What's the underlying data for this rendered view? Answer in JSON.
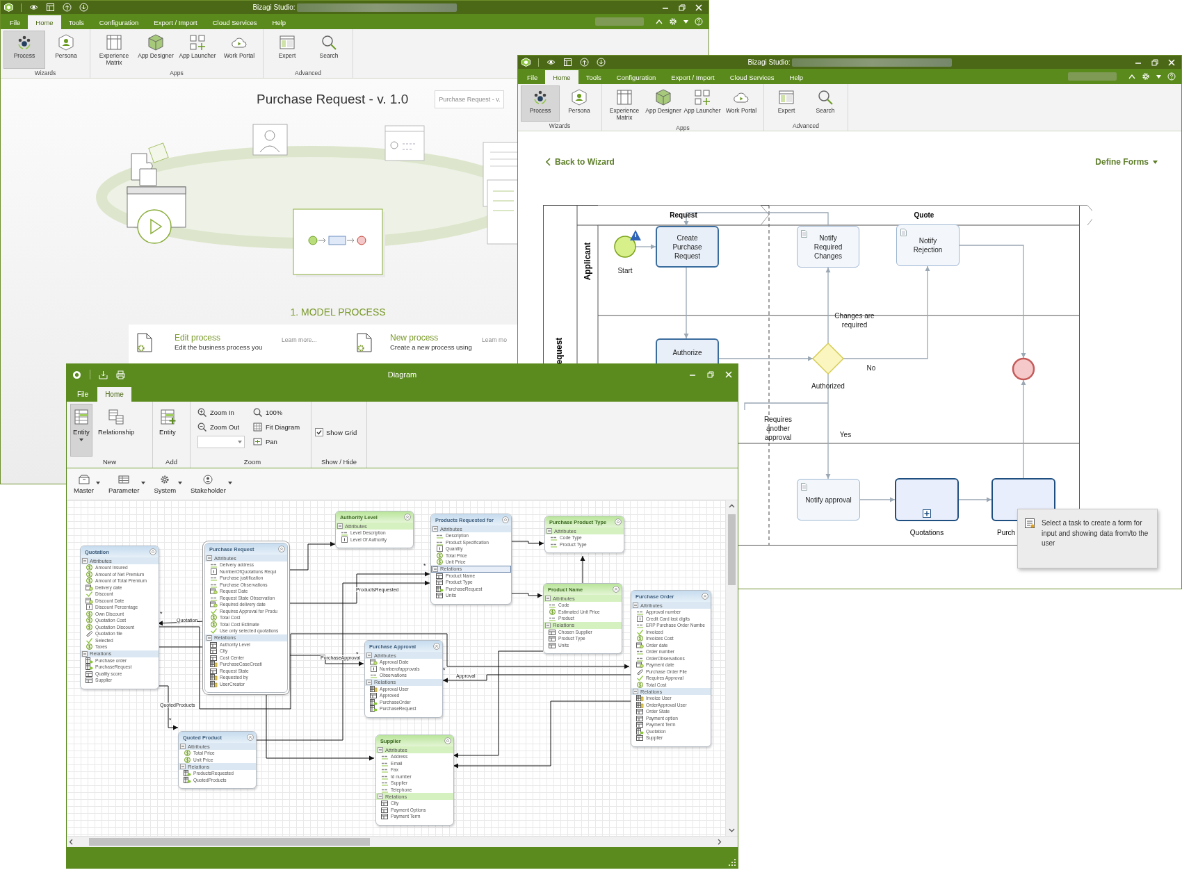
{
  "wizard_window": {
    "title": "Bizagi Studio:",
    "menu_tabs": [
      {
        "label": "File",
        "selected": false
      },
      {
        "label": "Home",
        "selected": true
      },
      {
        "label": "Tools",
        "selected": false
      },
      {
        "label": "Configuration",
        "selected": false
      },
      {
        "label": "Export / Import",
        "selected": false
      },
      {
        "label": "Cloud Services",
        "selected": false
      },
      {
        "label": "Help",
        "selected": false
      }
    ],
    "ribbon_groups": [
      {
        "label": "Wizards",
        "buttons": [
          {
            "label": "Process",
            "selected": true
          },
          {
            "label": "Persona",
            "selected": false
          }
        ]
      },
      {
        "label": "Apps",
        "buttons": [
          {
            "label": "Experience Matrix",
            "selected": false
          },
          {
            "label": "App Designer",
            "selected": false
          },
          {
            "label": "App Launcher",
            "selected": false
          },
          {
            "label": "Work Portal",
            "selected": false
          }
        ]
      },
      {
        "label": "Advanced",
        "buttons": [
          {
            "label": "Expert",
            "selected": false
          },
          {
            "label": "Search",
            "selected": false
          }
        ]
      }
    ],
    "process_title": "Purchase Request - v. 1.0",
    "process_search": {
      "value": "Purchase Request - v."
    },
    "step_title": "1. MODEL PROCESS",
    "options": [
      {
        "title": "Edit process",
        "description": "Edit the business process you",
        "link": "Learn more..."
      },
      {
        "title": "New process",
        "description": "Create a new process using",
        "link": "Learn mo"
      }
    ]
  },
  "process_window": {
    "title": "Bizagi Studio:",
    "menu_tabs": [
      {
        "label": "File",
        "selected": false
      },
      {
        "label": "Home",
        "selected": true
      },
      {
        "label": "Tools",
        "selected": false
      },
      {
        "label": "Configuration",
        "selected": false
      },
      {
        "label": "Export / Import",
        "selected": false
      },
      {
        "label": "Cloud Services",
        "selected": false
      },
      {
        "label": "Help",
        "selected": false
      }
    ],
    "ribbon_groups": [
      {
        "label": "Wizards",
        "buttons": [
          {
            "label": "Process",
            "selected": true
          },
          {
            "label": "Persona",
            "selected": false
          }
        ]
      },
      {
        "label": "Apps",
        "buttons": [
          {
            "label": "Experience Matrix",
            "selected": false
          },
          {
            "label": "App Designer",
            "selected": false
          },
          {
            "label": "App Launcher",
            "selected": false
          },
          {
            "label": "Work Portal",
            "selected": false
          }
        ]
      },
      {
        "label": "Advanced",
        "buttons": [
          {
            "label": "Expert",
            "selected": false
          },
          {
            "label": "Search",
            "selected": false
          }
        ]
      }
    ],
    "back_link": "Back to Wizard",
    "forms_menu": "Define Forms",
    "lanes": [
      {
        "label": "Applicant"
      },
      {
        "label": "equest"
      }
    ],
    "phases": [
      {
        "label": "Request"
      },
      {
        "label": "Quote"
      }
    ],
    "nodes": [
      {
        "kind": "start",
        "label": "Start",
        "warning": true
      },
      {
        "kind": "task",
        "label": "Create Purchase Request",
        "warning": false
      },
      {
        "kind": "notify",
        "label": "Notify Required Changes",
        "warning": false
      },
      {
        "kind": "notify",
        "label": "Notify Rejection",
        "warning": false
      },
      {
        "kind": "task",
        "label": "Authorize",
        "warning": false
      },
      {
        "kind": "gateway",
        "label": "Authorized",
        "warning": false
      },
      {
        "kind": "end",
        "warning": false
      },
      {
        "kind": "notify",
        "label": "Notify approval",
        "warning": false
      },
      {
        "kind": "subprocess",
        "label": "Quotations",
        "warning": false,
        "expand_marker": true
      },
      {
        "kind": "subprocess",
        "label": "Purch",
        "warning": false,
        "expand_marker": false
      }
    ],
    "flows": [
      {
        "arrow": true
      },
      {
        "arrow": true
      },
      {
        "arrow": true
      },
      {
        "arrow": true
      },
      {
        "arrow": true,
        "label": "Changes are required"
      },
      {
        "arrow": true,
        "label": "No"
      },
      {
        "arrow": true,
        "label": "Yes"
      },
      {
        "arrow": false,
        "label": "Requires another approval"
      },
      {
        "arrow": true
      },
      {
        "arrow": true
      },
      {
        "arrow": true
      },
      {
        "arrow": true
      }
    ],
    "tooltip": "Select a task to create a form for input and showing data from/to the user"
  },
  "diagram_window": {
    "title": "Diagram",
    "menu_tabs": [
      {
        "label": "File",
        "selected": false
      },
      {
        "label": "Home",
        "selected": true
      }
    ],
    "ribbon": {
      "new_group": {
        "label": "New",
        "buttons": [
          {
            "label": "Entity",
            "selected": true,
            "dropdown": true
          },
          {
            "label": "Relationship",
            "selected": false,
            "dropdown": false
          }
        ]
      },
      "add_group": {
        "label": "Add",
        "buttons": [
          {
            "label": "Entity",
            "selected": false,
            "dropdown": false
          }
        ]
      },
      "zoom_group": {
        "label": "Zoom",
        "commands": [
          {
            "label": "Zoom In"
          },
          {
            "label": "Zoom Out"
          },
          {
            "label": "100%"
          },
          {
            "label": "Fit Diagram"
          },
          {
            "label": "Pan"
          }
        ]
      },
      "show_group": {
        "label": "Show / Hide",
        "show_grid": {
          "label": "Show Grid",
          "checked": true
        }
      }
    },
    "toolbar": [
      {
        "label": "Master"
      },
      {
        "label": "Parameter"
      },
      {
        "label": "System"
      },
      {
        "label": "Stakeholder"
      }
    ],
    "entities": [
      {
        "name": "Quotation",
        "kind": "master",
        "selected": false,
        "sections": [
          {
            "label": "Attributes",
            "selected": false,
            "items": [
              {
                "label": "Amount Insured",
                "kind": "currency"
              },
              {
                "label": "Amount of Net Premium",
                "kind": "currency"
              },
              {
                "label": "Amount of Total Premium",
                "kind": "currency"
              },
              {
                "label": "Delivery date",
                "kind": "date"
              },
              {
                "label": "Discount",
                "kind": "boolean"
              },
              {
                "label": "Discount Date",
                "kind": "date"
              },
              {
                "label": "Discount Percentage",
                "kind": "number"
              },
              {
                "label": "Own Discount",
                "kind": "currency"
              },
              {
                "label": "Quotation Cost",
                "kind": "currency"
              },
              {
                "label": "Quotation Discount",
                "kind": "currency"
              },
              {
                "label": "Quotation file",
                "kind": "file"
              },
              {
                "label": "Selected",
                "kind": "boolean"
              },
              {
                "label": "Taxes",
                "kind": "currency"
              }
            ]
          },
          {
            "label": "Relations",
            "selected": false,
            "items": [
              {
                "label": "Purchase order",
                "kind": "collection"
              },
              {
                "label": "PurchaseRequest",
                "kind": "collection"
              },
              {
                "label": "Quality score",
                "kind": "table"
              },
              {
                "label": "Supplier",
                "kind": "table"
              }
            ]
          }
        ]
      },
      {
        "name": "Purchase Request",
        "kind": "master",
        "selected": true,
        "sections": [
          {
            "label": "Attributes",
            "selected": false,
            "items": [
              {
                "label": "Delivery address",
                "kind": "text"
              },
              {
                "label": "NumberOfQuotations Requi",
                "kind": "number"
              },
              {
                "label": "Purchase justification",
                "kind": "text"
              },
              {
                "label": "Purchase Observations",
                "kind": "text"
              },
              {
                "label": "Request Date",
                "kind": "date"
              },
              {
                "label": "Request State Observation",
                "kind": "text"
              },
              {
                "label": "Required delivery date",
                "kind": "date"
              },
              {
                "label": "Requires Approval for Produ",
                "kind": "boolean"
              },
              {
                "label": "Total Cost",
                "kind": "currency"
              },
              {
                "label": "Total Cost Estimate",
                "kind": "currency"
              },
              {
                "label": "Use only selected quotations",
                "kind": "boolean"
              }
            ]
          },
          {
            "label": "Relations",
            "selected": false,
            "items": [
              {
                "label": "Authority Level",
                "kind": "table"
              },
              {
                "label": "City",
                "kind": "table"
              },
              {
                "label": "Cost Center",
                "kind": "table"
              },
              {
                "label": "PurchaseCaseCreati",
                "kind": "user"
              },
              {
                "label": "Request State",
                "kind": "table"
              },
              {
                "label": "Requested by",
                "kind": "user"
              },
              {
                "label": "UserCreator",
                "kind": "user"
              }
            ]
          }
        ]
      },
      {
        "name": "Authority Level",
        "kind": "parameter",
        "selected": false,
        "sections": [
          {
            "label": "Attributes",
            "selected": false,
            "items": [
              {
                "label": "Level Description",
                "kind": "text"
              },
              {
                "label": "Level Of Authority",
                "kind": "number"
              }
            ]
          }
        ]
      },
      {
        "name": "Products Requested for",
        "kind": "master",
        "selected": false,
        "sections": [
          {
            "label": "Attributes",
            "selected": false,
            "items": [
              {
                "label": "Description",
                "kind": "text"
              },
              {
                "label": "Product Specification",
                "kind": "text"
              },
              {
                "label": "Quantity",
                "kind": "number"
              },
              {
                "label": "Total Price",
                "kind": "currency"
              },
              {
                "label": "Unit Price",
                "kind": "currency"
              }
            ]
          },
          {
            "label": "Relations",
            "selected": true,
            "items": [
              {
                "label": "Product Name",
                "kind": "table"
              },
              {
                "label": "Product Type",
                "kind": "table"
              },
              {
                "label": "PurchaseRequest",
                "kind": "collection"
              },
              {
                "label": "Units",
                "kind": "table"
              }
            ]
          }
        ]
      },
      {
        "name": "Purchase Product Type",
        "kind": "parameter",
        "selected": false,
        "sections": [
          {
            "label": "Attributes",
            "selected": false,
            "items": [
              {
                "label": "Code Type",
                "kind": "text"
              },
              {
                "label": "Product Type",
                "kind": "text"
              }
            ]
          }
        ]
      },
      {
        "name": "Product Name",
        "kind": "parameter",
        "selected": false,
        "sections": [
          {
            "label": "Attributes",
            "selected": false,
            "items": [
              {
                "label": "Code",
                "kind": "text"
              },
              {
                "label": "Estimated Unit Price",
                "kind": "currency"
              },
              {
                "label": "Product",
                "kind": "text"
              }
            ]
          },
          {
            "label": "Relations",
            "selected": false,
            "items": [
              {
                "label": "Chosen Supplier",
                "kind": "table"
              },
              {
                "label": "Product Type",
                "kind": "table"
              },
              {
                "label": "Units",
                "kind": "table"
              }
            ]
          }
        ]
      },
      {
        "name": "Purchase Order",
        "kind": "master",
        "selected": false,
        "sections": [
          {
            "label": "Attributes",
            "selected": false,
            "items": [
              {
                "label": "Approval number",
                "kind": "text"
              },
              {
                "label": "Credit Card last digits",
                "kind": "number"
              },
              {
                "label": "ERP Purchase Order Numbe",
                "kind": "text"
              },
              {
                "label": "Invoiced",
                "kind": "boolean"
              },
              {
                "label": "Invoices Cost",
                "kind": "currency"
              },
              {
                "label": "Order date",
                "kind": "date"
              },
              {
                "label": "Order number",
                "kind": "text"
              },
              {
                "label": "OrderObservations",
                "kind": "text"
              },
              {
                "label": "Payment date",
                "kind": "date"
              },
              {
                "label": "Purchase Order File",
                "kind": "file"
              },
              {
                "label": "Requires Approval",
                "kind": "boolean"
              },
              {
                "label": "Total Cost",
                "kind": "currency"
              }
            ]
          },
          {
            "label": "Relations",
            "selected": false,
            "items": [
              {
                "label": "Invoice User",
                "kind": "user"
              },
              {
                "label": "OrderApproval User",
                "kind": "user"
              },
              {
                "label": "Order State",
                "kind": "table"
              },
              {
                "label": "Payment option",
                "kind": "table"
              },
              {
                "label": "Payment Term",
                "kind": "table"
              },
              {
                "label": "Quotation",
                "kind": "collection"
              },
              {
                "label": "Supplier",
                "kind": "table"
              }
            ]
          }
        ]
      },
      {
        "name": "Purchase Approval",
        "kind": "master",
        "selected": false,
        "sections": [
          {
            "label": "Attributes",
            "selected": false,
            "items": [
              {
                "label": "Approval Date",
                "kind": "date"
              },
              {
                "label": "Numberofapprovals",
                "kind": "number"
              },
              {
                "label": "Observations",
                "kind": "text"
              }
            ]
          },
          {
            "label": "Relations",
            "selected": false,
            "items": [
              {
                "label": "Approval User",
                "kind": "user"
              },
              {
                "label": "Approved",
                "kind": "table"
              },
              {
                "label": "PurchaseOrder",
                "kind": "collection"
              },
              {
                "label": "PurchaseRequest",
                "kind": "collection"
              }
            ]
          }
        ]
      },
      {
        "name": "Quoted Product",
        "kind": "master",
        "selected": false,
        "sections": [
          {
            "label": "Attributes",
            "selected": false,
            "items": [
              {
                "label": "Total Price",
                "kind": "currency"
              },
              {
                "label": "Unit Price",
                "kind": "currency"
              }
            ]
          },
          {
            "label": "Relations",
            "selected": false,
            "items": [
              {
                "label": "ProductsRequested",
                "kind": "collection"
              },
              {
                "label": "QuotedProducts",
                "kind": "collection"
              }
            ]
          }
        ]
      },
      {
        "name": "Supplier",
        "kind": "parameter",
        "selected": false,
        "sections": [
          {
            "label": "Attributes",
            "selected": false,
            "items": [
              {
                "label": "Address",
                "kind": "text"
              },
              {
                "label": "Email",
                "kind": "text"
              },
              {
                "label": "Fax",
                "kind": "text"
              },
              {
                "label": "Id number",
                "kind": "text"
              },
              {
                "label": "Supplier",
                "kind": "text"
              },
              {
                "label": "Telephone",
                "kind": "text"
              }
            ]
          },
          {
            "label": "Relations",
            "selected": false,
            "items": [
              {
                "label": "City",
                "kind": "table"
              },
              {
                "label": "Payment Options",
                "kind": "table"
              },
              {
                "label": "Payment Term",
                "kind": "table"
              }
            ]
          }
        ]
      }
    ],
    "connectors": [
      {
        "arrow": true
      },
      {
        "arrow": true,
        "label": "ProductsRequested",
        "multiplicity": "*"
      },
      {
        "arrow": true
      },
      {
        "arrow": true,
        "label": "Quotation",
        "multiplicity": "*"
      },
      {
        "arrow": true,
        "label": "QuotedProducts",
        "multiplicity": "*"
      },
      {
        "arrow": true
      },
      {
        "arrow": true
      },
      {
        "arrow": true,
        "label": "PurchaseApproval",
        "multiplicity": "*"
      },
      {
        "arrow": true,
        "label": "Approval",
        "multiplicity": "*"
      },
      {
        "arrow": true
      },
      {
        "arrow": true
      },
      {
        "arrow": true
      },
      {
        "arrow": true
      },
      {
        "arrow": true
      }
    ]
  }
}
